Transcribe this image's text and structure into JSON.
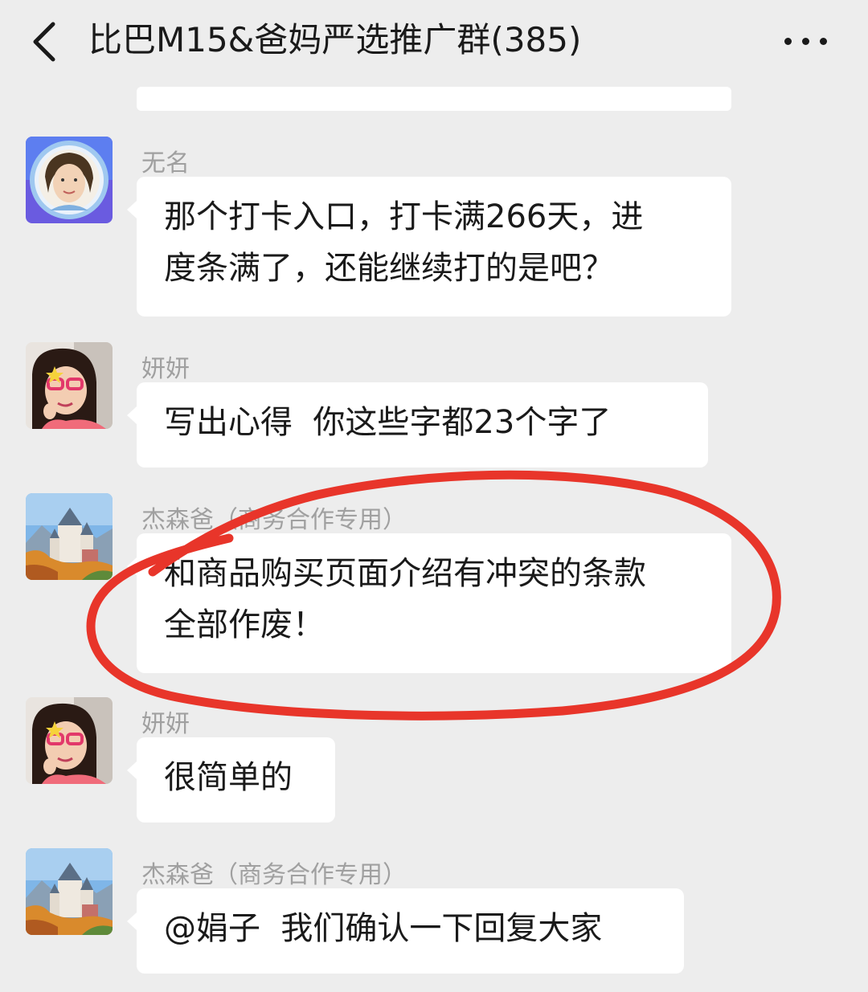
{
  "header": {
    "title": "比巴M15&爸妈严选推广群(385)"
  },
  "messages": [
    {
      "sender": "无名",
      "text": "那个打卡入口，打卡满266天，进\n度条满了，还能继续打的是吧？",
      "avatar": "woman-portrait-blue-frame"
    },
    {
      "sender": "妍妍",
      "text": "写出心得  你这些字都23个字了",
      "avatar": "girl-pink-glasses"
    },
    {
      "sender": "杰森爸（商务合作专用）",
      "text": "和商品购买页面介绍有冲突的条款\n全部作废！",
      "avatar": "castle-landscape"
    },
    {
      "sender": "妍妍",
      "text": "很简单的",
      "avatar": "girl-pink-glasses"
    },
    {
      "sender": "杰森爸（商务合作专用）",
      "text": "@娟子  我们确认一下回复大家",
      "avatar": "castle-landscape"
    }
  ],
  "annotation": {
    "color": "#e8352a"
  }
}
